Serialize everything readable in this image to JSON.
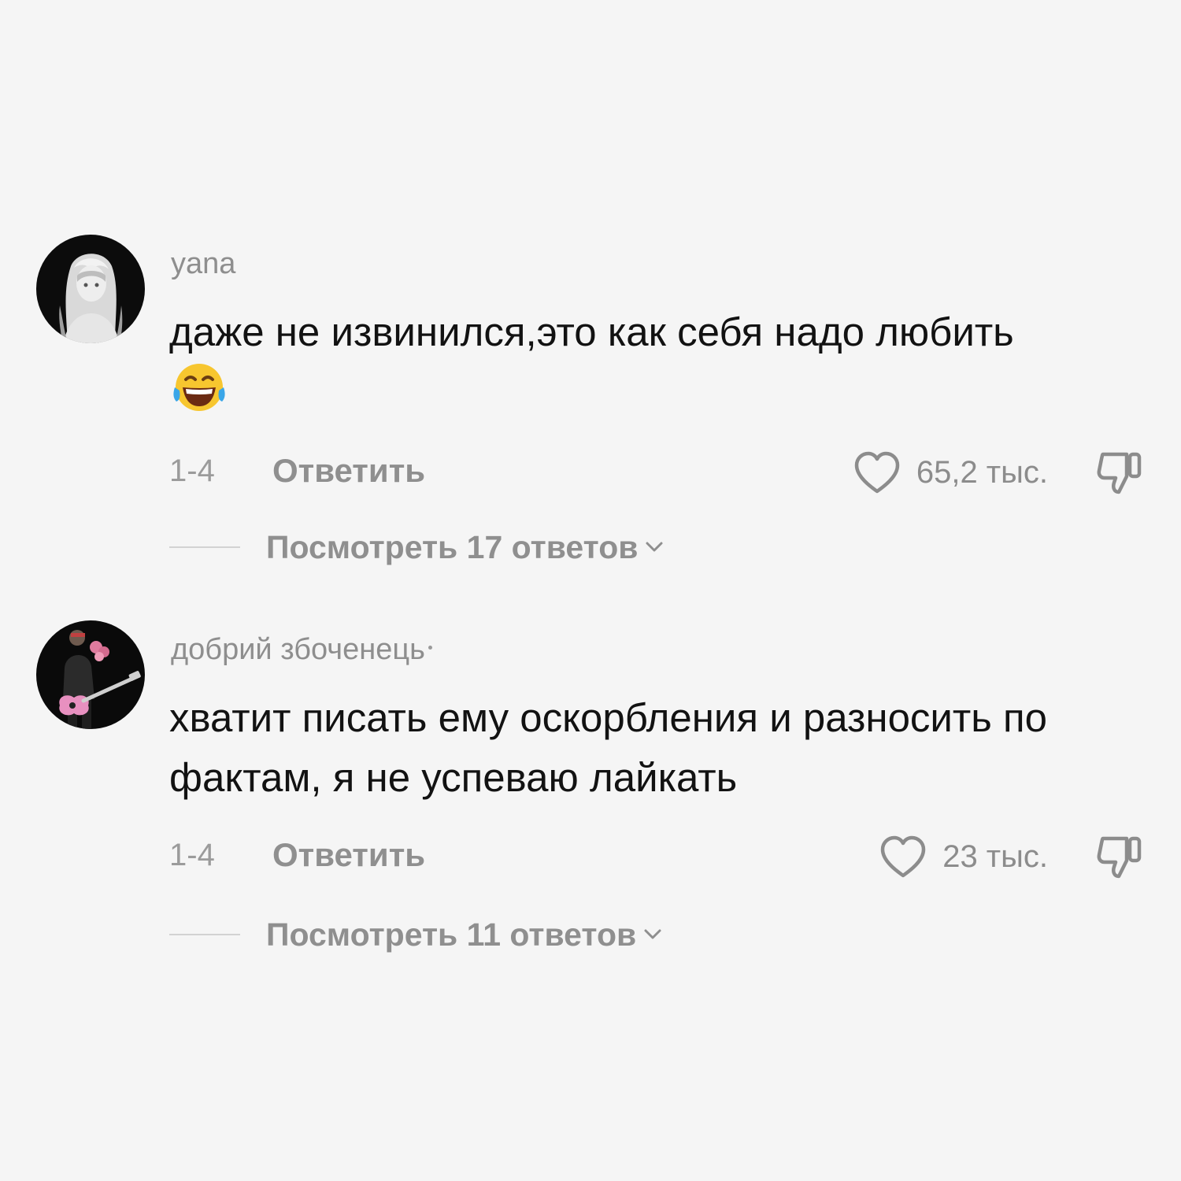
{
  "comments": [
    {
      "username": "yana",
      "text": "даже не извинился,это как себя надо любить",
      "emoji": "😂",
      "avatar_icon": "anime-girl-avatar",
      "time": "1-4",
      "reply_label": "Ответить",
      "likes": "65,2 тыс.",
      "view_replies": "Посмотреть 17 ответов"
    },
    {
      "username": "добрий збоченець",
      "text": "хватит писать ему оскорбления и разносить по фактам, я не успеваю лайкать",
      "avatar_icon": "guitarist-avatar",
      "time": "1-4",
      "reply_label": "Ответить",
      "likes": "23 тыс.",
      "view_replies": "Посмотреть 11 ответов"
    }
  ],
  "icons": {
    "like": "heart-outline-icon",
    "dislike": "thumbs-down-icon",
    "expand": "chevron-down-icon"
  },
  "colors": {
    "background": "#f5f5f5",
    "text": "#121212",
    "secondary": "#8e8e8e",
    "divider": "#d2d2d2"
  }
}
